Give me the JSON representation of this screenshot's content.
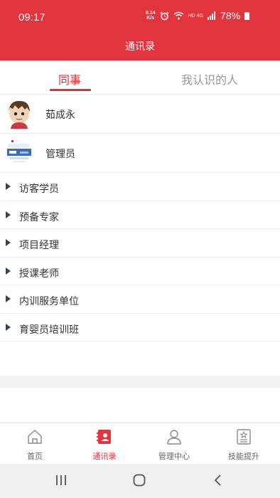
{
  "status_bar": {
    "time": "09:17",
    "net_speed_value": "0.14",
    "net_speed_unit": "K/s",
    "network_label": "HD 4G",
    "battery": "78%"
  },
  "header": {
    "title": "通讯录"
  },
  "tabs": [
    {
      "label": "同事",
      "active": true
    },
    {
      "label": "我认识的人",
      "active": false
    }
  ],
  "people": [
    {
      "name": "茹成永",
      "avatar": "cartoon-avatar"
    },
    {
      "name": "管理员",
      "avatar": "landscape-avatar"
    }
  ],
  "groups": [
    {
      "label": "访客学员"
    },
    {
      "label": "预备专家"
    },
    {
      "label": "项目经理"
    },
    {
      "label": "授课老师"
    },
    {
      "label": "内训服务单位"
    },
    {
      "label": "育婴员培训班"
    }
  ],
  "bottom_nav": [
    {
      "label": "首页",
      "icon": "home-icon",
      "active": false
    },
    {
      "label": "通讯录",
      "icon": "contacts-icon",
      "active": true
    },
    {
      "label": "管理中心",
      "icon": "user-icon",
      "active": false
    },
    {
      "label": "技能提升",
      "icon": "certificate-icon",
      "active": false
    }
  ],
  "colors": {
    "brand": "#e1343f",
    "tab_active": "#d9313b"
  }
}
